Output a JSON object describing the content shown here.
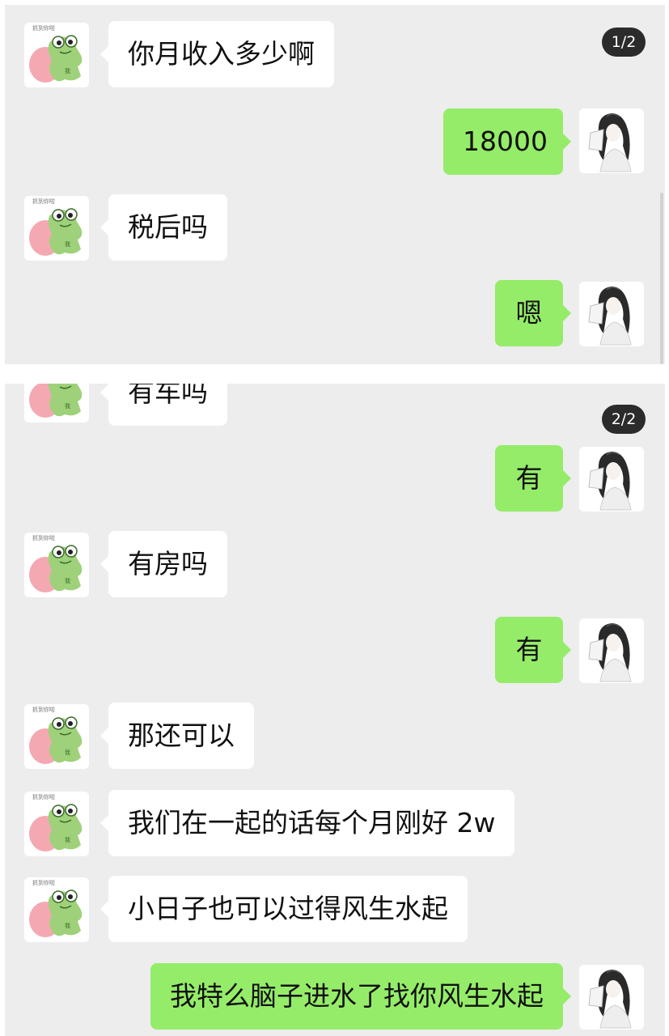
{
  "pages": [
    {
      "badge": "1/2",
      "messages": [
        {
          "from": "them",
          "avatar": "frog-sticker-icon",
          "text": "你月收入多少啊"
        },
        {
          "from": "me",
          "avatar": "anime-girl-avatar-icon",
          "text": "18000"
        },
        {
          "from": "them",
          "avatar": "frog-sticker-icon",
          "text": "税后吗"
        },
        {
          "from": "me",
          "avatar": "anime-girl-avatar-icon",
          "text": "嗯"
        }
      ]
    },
    {
      "badge": "2/2",
      "messages": [
        {
          "from": "them",
          "avatar": "frog-sticker-icon",
          "text": "有车吗"
        },
        {
          "from": "me",
          "avatar": "anime-girl-avatar-icon",
          "text": "有"
        },
        {
          "from": "them",
          "avatar": "frog-sticker-icon",
          "text": "有房吗"
        },
        {
          "from": "me",
          "avatar": "anime-girl-avatar-icon",
          "text": "有"
        },
        {
          "from": "them",
          "avatar": "frog-sticker-icon",
          "text": "那还可以"
        },
        {
          "from": "them",
          "avatar": "frog-sticker-icon",
          "text": "我们在一起的话每个月刚好 2w"
        },
        {
          "from": "them",
          "avatar": "frog-sticker-icon",
          "text": "小日子也可以过得风生水起"
        },
        {
          "from": "me",
          "avatar": "anime-girl-avatar-icon",
          "text": "我特么脑子进水了找你风生水起"
        }
      ]
    }
  ],
  "colors": {
    "panel_background": "#ededed",
    "incoming_bubble": "#ffffff",
    "outgoing_bubble": "#95ec69",
    "badge_background": "#2b2b2b"
  }
}
